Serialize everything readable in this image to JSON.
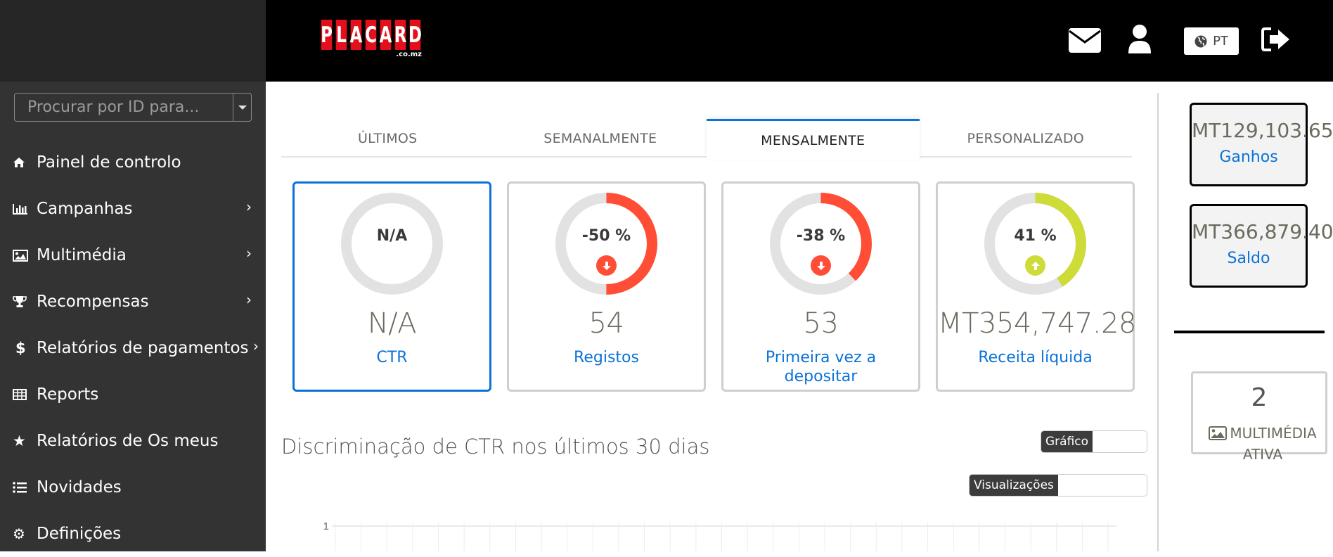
{
  "sidebar": {
    "search": {
      "placeholder": "Procurar por ID para..."
    },
    "items": [
      {
        "label": "Painel de controlo",
        "icon": "home-icon",
        "has_submenu": false
      },
      {
        "label": "Campanhas",
        "icon": "bar-chart-icon",
        "has_submenu": true
      },
      {
        "label": "Multimédia",
        "icon": "image-icon",
        "has_submenu": true
      },
      {
        "label": "Recompensas",
        "icon": "trophy-icon",
        "has_submenu": true
      },
      {
        "label": "Relatórios de pagamentos",
        "icon": "dollar-icon",
        "has_submenu": true
      },
      {
        "label": "Reports",
        "icon": "table-icon",
        "has_submenu": false
      },
      {
        "label": "Relatórios de Os meus",
        "icon": "star-icon",
        "has_submenu": false
      },
      {
        "label": "Novidades",
        "icon": "list-icon",
        "has_submenu": false
      },
      {
        "label": "Definições",
        "icon": "gear-icon",
        "has_submenu": false
      }
    ]
  },
  "header": {
    "logo_text": "PLACARD",
    "logo_sub": ".co.mz",
    "language": "PT",
    "icons": [
      "envelope-icon",
      "user-icon",
      "globe-icon",
      "logout-icon"
    ]
  },
  "tabs": [
    {
      "label": "ÚLTIMOS",
      "active": false
    },
    {
      "label": "SEMANALMENTE",
      "active": false
    },
    {
      "label": "MENSALMENTE",
      "active": true
    },
    {
      "label": "PERSONALIZADO",
      "active": false
    }
  ],
  "cards": [
    {
      "pct_label": "N/A",
      "pct": null,
      "trend": "none",
      "value": "N/A",
      "label": "CTR",
      "active": true
    },
    {
      "pct_label": "-50 %",
      "pct": -50,
      "trend": "down",
      "value": "54",
      "label": "Registos",
      "active": false
    },
    {
      "pct_label": "-38 %",
      "pct": -38,
      "trend": "down",
      "value": "53",
      "label": "Primeira vez a depositar",
      "active": false
    },
    {
      "pct_label": "41 %",
      "pct": 41,
      "trend": "up",
      "value": "MT354,747.28",
      "label": "Receita líquida",
      "active": false
    }
  ],
  "colors": {
    "accent": "#0a72d8",
    "down": "#ff4d36",
    "up": "#cddc39",
    "gauge_track": "#e2e2e2"
  },
  "section": {
    "title": "Discriminação de CTR nos últimos 30 dias",
    "view_toggle_label": "Gráfico",
    "metric_toggle_label": "Visualizações"
  },
  "chart_data": {
    "type": "line",
    "title": "Discriminação de CTR nos últimos 30 dias",
    "xlabel": "",
    "ylabel": "",
    "y_ticks": [
      "1"
    ],
    "ylim": [
      0,
      1
    ],
    "x_count": 30,
    "grid": true,
    "series": []
  },
  "rightcol": {
    "stats": [
      {
        "value": "MT129,103.65",
        "label": "Ganhos"
      },
      {
        "value": "MT366,879.40",
        "label": "Saldo"
      }
    ],
    "media": {
      "count": "2",
      "label": "MULTIMÉDIA ATIVA"
    }
  }
}
